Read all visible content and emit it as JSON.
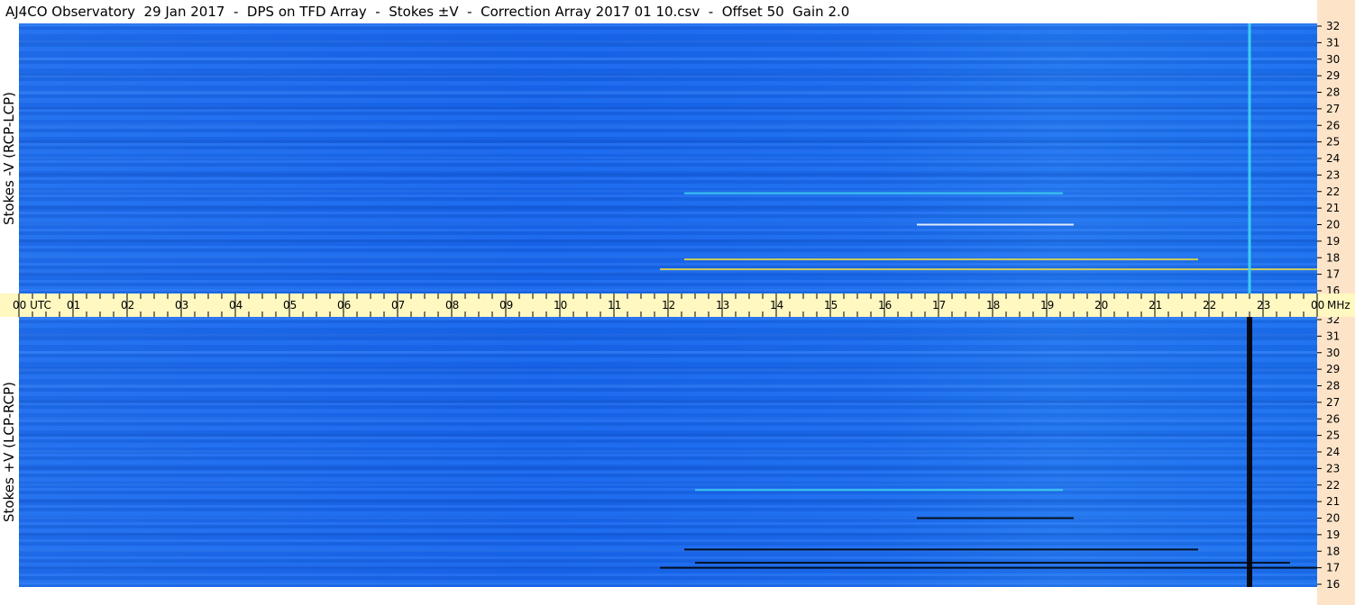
{
  "title": "AJ4CO Observatory  29 Jan 2017  -  DPS on TFD Array  -  Stokes ±V  -  Correction Array 2017 01 10.csv  -  Offset 50  Gain 2.0",
  "top_panel": {
    "ylabel": "Stokes -V (RCP-LCP)"
  },
  "bottom_panel": {
    "ylabel": "Stokes +V (LCP-RCP)"
  },
  "colors": {
    "background_blue": "#1a6cf0",
    "dark_line": "#000000",
    "yellow_line": "#f0e040",
    "cyan_line": "#40d8f0",
    "time_axis_bg": "#fff8c0",
    "freq_axis_bg": "#fde4c8"
  },
  "chart_data": {
    "type": "heatmap",
    "title": "AJ4CO Observatory  29 Jan 2017  -  DPS on TFD Array  -  Stokes ±V  -  Correction Array 2017 01 10.csv  -  Offset 50  Gain 2.0",
    "x_axis": {
      "label": "UTC",
      "ticks": [
        "00 UTC",
        "01",
        "02",
        "03",
        "04",
        "05",
        "06",
        "07",
        "08",
        "09",
        "10",
        "11",
        "12",
        "13",
        "14",
        "15",
        "16",
        "17",
        "18",
        "19",
        "20",
        "21",
        "22",
        "23",
        "00"
      ],
      "range": [
        0,
        24
      ]
    },
    "y_axis": {
      "unit": "MHz",
      "ticks": [
        32,
        31,
        30,
        29,
        28,
        27,
        26,
        25,
        24,
        23,
        22,
        21,
        20,
        19,
        18,
        17,
        16
      ],
      "range": [
        16,
        32
      ]
    },
    "panels": [
      {
        "name": "Stokes -V (RCP-LCP)",
        "features": [
          {
            "kind": "interference_line",
            "freq_mhz": 17.3,
            "start_utc": 11.85,
            "end_utc": 24.0,
            "color": "yellow"
          },
          {
            "kind": "interference_line",
            "freq_mhz": 17.9,
            "start_utc": 12.3,
            "end_utc": 21.8,
            "color": "yellow"
          },
          {
            "kind": "interference_line",
            "freq_mhz": 21.9,
            "start_utc": 12.3,
            "end_utc": 19.3,
            "color": "cyan"
          },
          {
            "kind": "interference_line",
            "freq_mhz": 20.0,
            "start_utc": 16.6,
            "end_utc": 19.5,
            "color": "white"
          },
          {
            "kind": "vertical_line",
            "utc": 22.75,
            "color": "cyan"
          }
        ]
      },
      {
        "name": "Stokes +V (LCP-RCP)",
        "features": [
          {
            "kind": "interference_line",
            "freq_mhz": 17.0,
            "start_utc": 11.85,
            "end_utc": 24.0,
            "color": "black"
          },
          {
            "kind": "interference_line",
            "freq_mhz": 17.3,
            "start_utc": 12.5,
            "end_utc": 23.5,
            "color": "black"
          },
          {
            "kind": "interference_line",
            "freq_mhz": 18.1,
            "start_utc": 12.3,
            "end_utc": 21.8,
            "color": "black"
          },
          {
            "kind": "interference_line",
            "freq_mhz": 20.0,
            "start_utc": 16.6,
            "end_utc": 19.5,
            "color": "black"
          },
          {
            "kind": "interference_line",
            "freq_mhz": 21.7,
            "start_utc": 12.5,
            "end_utc": 19.3,
            "color": "cyan"
          },
          {
            "kind": "vertical_line",
            "utc": 22.75,
            "color": "black"
          }
        ]
      }
    ],
    "mhz_label": "MHz",
    "utc_label": "UTC"
  }
}
